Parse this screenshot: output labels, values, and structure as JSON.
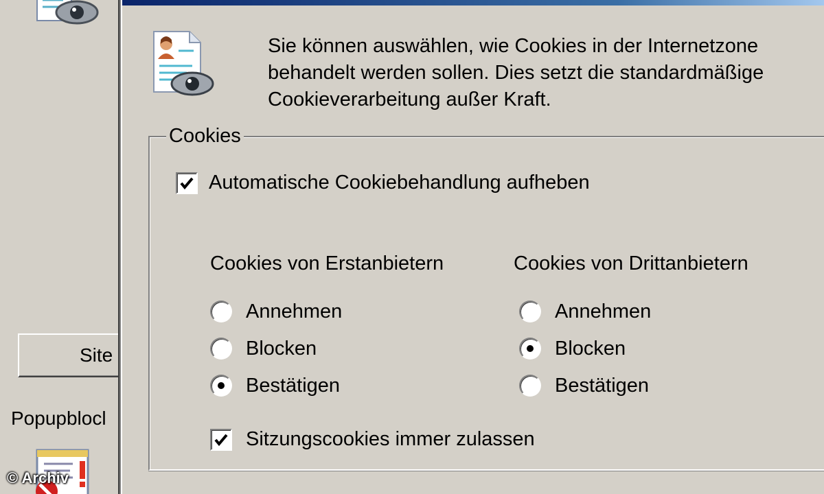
{
  "background_dialog": {
    "sites_button_label": "Site",
    "popup_label": "Popupblocl"
  },
  "watermark": "© Archiv",
  "dialog": {
    "description_lines": [
      "Sie können auswählen, wie Cookies in der Internetzone",
      "behandelt werden sollen. Dies setzt die standardmäßige",
      "Cookieverarbeitung außer Kraft."
    ],
    "group_title": "Cookies",
    "override_checkbox": {
      "label": "Automatische Cookiebehandlung aufheben",
      "checked": true
    },
    "first_party": {
      "title": "Cookies von Erstanbietern",
      "options": [
        "Annehmen",
        "Blocken",
        "Bestätigen"
      ],
      "selected": "Bestätigen"
    },
    "third_party": {
      "title": "Cookies von Drittanbietern",
      "options": [
        "Annehmen",
        "Blocken",
        "Bestätigen"
      ],
      "selected": "Blocken"
    },
    "session_checkbox": {
      "label": "Sitzungscookies immer zulassen",
      "checked": true
    }
  },
  "colors": {
    "dialog_background": "#d4d0c8",
    "titlebar_start": "#0a246a",
    "titlebar_end": "#a6caf0"
  },
  "icons": [
    "document-eye-icon",
    "popup-blocker-icon",
    "check-icon"
  ]
}
